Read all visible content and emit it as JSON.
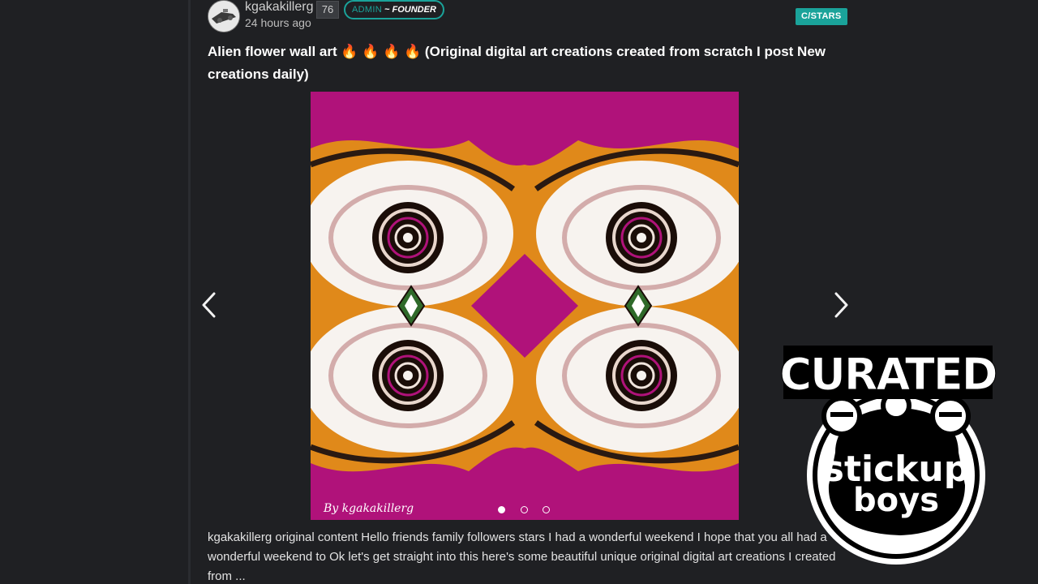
{
  "post": {
    "author": "kgakakillerg",
    "reputation": "76",
    "role_admin": "ADMIN",
    "role_founder": "~ FOUNDER",
    "time": "24 hours ago",
    "community": "C/STARS",
    "title": "Alien flower wall art 🔥 🔥 🔥 🔥 (Original digital art creations created from scratch I post New creations daily)",
    "image_watermark": "By kgakakillerg",
    "body": "kgakakillerg original content Hello friends family followers stars I had a wonderful weekend I hope that you all had a wonderful weekend to Ok let's get straight into this here's some beautiful unique original digital art creations I created from ..."
  },
  "carousel": {
    "slide_count": 3,
    "active_index": 0
  },
  "overlay": {
    "logo_top": "CURATED",
    "logo_line1": "stickup",
    "logo_line2": "boys"
  },
  "icons": {
    "prev": "chevron-left-icon",
    "next": "chevron-right-icon"
  },
  "colors": {
    "background": "#1f2023",
    "accent": "#1aa39a",
    "art_magenta": "#b0127a",
    "art_orange": "#e0891a"
  }
}
